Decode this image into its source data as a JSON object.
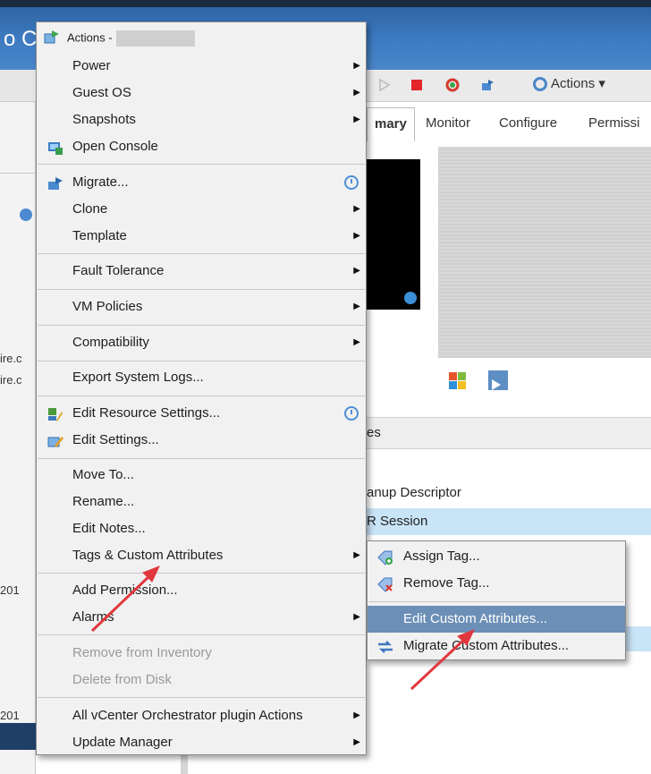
{
  "background": {
    "title_fragment": "o C",
    "toolbar_actions_label": "Actions",
    "tabs": [
      "mary",
      "Monitor",
      "Configure",
      "Permissi"
    ],
    "section_header": "es",
    "rows": [
      "anup Descriptor",
      "R Session"
    ],
    "left_fragments": [
      "ire.c",
      "ire.c",
      "201",
      "201"
    ]
  },
  "menu": {
    "header_label": "Actions -",
    "items": [
      {
        "label": "Power"
      },
      {
        "label": "Guest OS"
      },
      {
        "label": "Snapshots"
      },
      {
        "label": "Open Console"
      },
      {
        "label": "Migrate..."
      },
      {
        "label": "Clone"
      },
      {
        "label": "Template"
      },
      {
        "label": "Fault Tolerance"
      },
      {
        "label": "VM Policies"
      },
      {
        "label": "Compatibility"
      },
      {
        "label": "Export System Logs..."
      },
      {
        "label": "Edit Resource Settings..."
      },
      {
        "label": "Edit Settings..."
      },
      {
        "label": "Move To..."
      },
      {
        "label": "Rename..."
      },
      {
        "label": "Edit Notes..."
      },
      {
        "label": "Tags & Custom Attributes"
      },
      {
        "label": "Add Permission..."
      },
      {
        "label": "Alarms"
      },
      {
        "label": "Remove from Inventory"
      },
      {
        "label": "Delete from Disk"
      },
      {
        "label": "All vCenter Orchestrator plugin Actions"
      },
      {
        "label": "Update Manager"
      }
    ]
  },
  "submenu": {
    "items": [
      {
        "label": "Assign Tag..."
      },
      {
        "label": "Remove Tag..."
      },
      {
        "label": "Edit Custom Attributes..."
      },
      {
        "label": "Migrate Custom Attributes..."
      }
    ]
  },
  "colors": {
    "menu_bg": "#f1f1f1",
    "selected_bg": "#6c8fb7",
    "highlight_row": "#c9e4f7",
    "annotation_arrow": "#e0383e",
    "header_blue": "#3d7ac0"
  }
}
